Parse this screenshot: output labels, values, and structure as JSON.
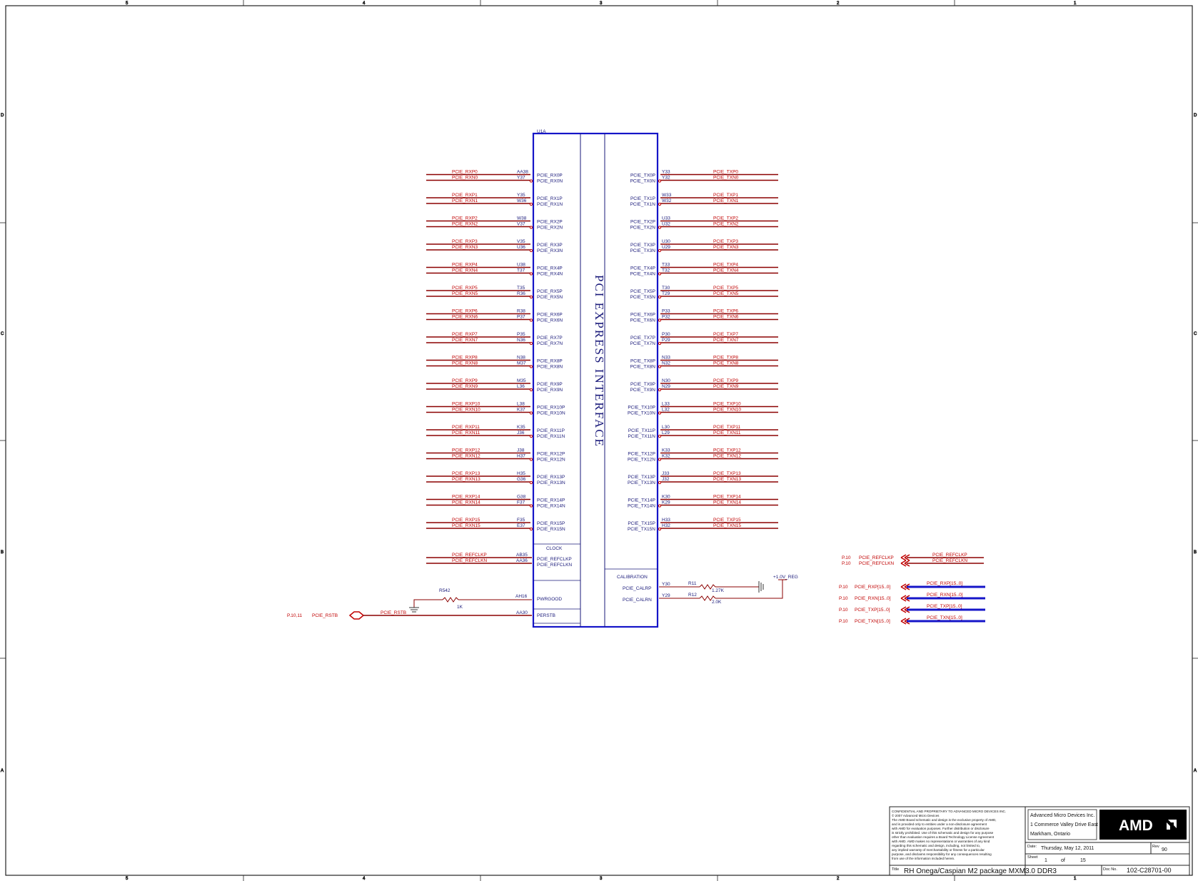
{
  "zones": {
    "top": [
      "5",
      "4",
      "3",
      "2",
      "1"
    ],
    "side": [
      "D",
      "C",
      "B",
      "A"
    ]
  },
  "chip": {
    "ref": "U1A",
    "title": "PCI EXPRESS INTERFACE",
    "clock_label": "CLOCK",
    "calibration_label": "CALIBRATION"
  },
  "rx_lanes": [
    {
      "net_p": "PCIE_RXP0",
      "net_n": "PCIE_RXN0",
      "ball_p": "AA38",
      "ball_n": "Y37",
      "pin_p": "PCIE_RX0P",
      "pin_n": "PCIE_RX0N"
    },
    {
      "net_p": "PCIE_RXP1",
      "net_n": "PCIE_RXN1",
      "ball_p": "Y35",
      "ball_n": "W36",
      "pin_p": "PCIE_RX1P",
      "pin_n": "PCIE_RX1N"
    },
    {
      "net_p": "PCIE_RXP2",
      "net_n": "PCIE_RXN2",
      "ball_p": "W38",
      "ball_n": "V37",
      "pin_p": "PCIE_RX2P",
      "pin_n": "PCIE_RX2N"
    },
    {
      "net_p": "PCIE_RXP3",
      "net_n": "PCIE_RXN3",
      "ball_p": "V35",
      "ball_n": "U36",
      "pin_p": "PCIE_RX3P",
      "pin_n": "PCIE_RX3N"
    },
    {
      "net_p": "PCIE_RXP4",
      "net_n": "PCIE_RXN4",
      "ball_p": "U38",
      "ball_n": "T37",
      "pin_p": "PCIE_RX4P",
      "pin_n": "PCIE_RX4N"
    },
    {
      "net_p": "PCIE_RXP5",
      "net_n": "PCIE_RXN5",
      "ball_p": "T35",
      "ball_n": "R36",
      "pin_p": "PCIE_RX5P",
      "pin_n": "PCIE_RX5N"
    },
    {
      "net_p": "PCIE_RXP6",
      "net_n": "PCIE_RXN6",
      "ball_p": "R38",
      "ball_n": "P37",
      "pin_p": "PCIE_RX6P",
      "pin_n": "PCIE_RX6N"
    },
    {
      "net_p": "PCIE_RXP7",
      "net_n": "PCIE_RXN7",
      "ball_p": "P35",
      "ball_n": "N36",
      "pin_p": "PCIE_RX7P",
      "pin_n": "PCIE_RX7N"
    },
    {
      "net_p": "PCIE_RXP8",
      "net_n": "PCIE_RXN8",
      "ball_p": "N38",
      "ball_n": "M37",
      "pin_p": "PCIE_RX8P",
      "pin_n": "PCIE_RX8N"
    },
    {
      "net_p": "PCIE_RXP9",
      "net_n": "PCIE_RXN9",
      "ball_p": "M35",
      "ball_n": "L36",
      "pin_p": "PCIE_RX9P",
      "pin_n": "PCIE_RX9N"
    },
    {
      "net_p": "PCIE_RXP10",
      "net_n": "PCIE_RXN10",
      "ball_p": "L38",
      "ball_n": "K37",
      "pin_p": "PCIE_RX10P",
      "pin_n": "PCIE_RX10N"
    },
    {
      "net_p": "PCIE_RXP11",
      "net_n": "PCIE_RXN11",
      "ball_p": "K35",
      "ball_n": "J36",
      "pin_p": "PCIE_RX11P",
      "pin_n": "PCIE_RX11N"
    },
    {
      "net_p": "PCIE_RXP12",
      "net_n": "PCIE_RXN12",
      "ball_p": "J38",
      "ball_n": "H37",
      "pin_p": "PCIE_RX12P",
      "pin_n": "PCIE_RX12N"
    },
    {
      "net_p": "PCIE_RXP13",
      "net_n": "PCIE_RXN13",
      "ball_p": "H35",
      "ball_n": "G36",
      "pin_p": "PCIE_RX13P",
      "pin_n": "PCIE_RX13N"
    },
    {
      "net_p": "PCIE_RXP14",
      "net_n": "PCIE_RXN14",
      "ball_p": "G38",
      "ball_n": "F37",
      "pin_p": "PCIE_RX14P",
      "pin_n": "PCIE_RX14N"
    },
    {
      "net_p": "PCIE_RXP15",
      "net_n": "PCIE_RXN15",
      "ball_p": "F35",
      "ball_n": "E37",
      "pin_p": "PCIE_RX15P",
      "pin_n": "PCIE_RX15N"
    }
  ],
  "tx_lanes": [
    {
      "net_p": "PCIE_TXP0",
      "net_n": "PCIE_TXN0",
      "ball_p": "Y33",
      "ball_n": "Y32",
      "pin_p": "PCIE_TX0P",
      "pin_n": "PCIE_TX0N"
    },
    {
      "net_p": "PCIE_TXP1",
      "net_n": "PCIE_TXN1",
      "ball_p": "W33",
      "ball_n": "W32",
      "pin_p": "PCIE_TX1P",
      "pin_n": "PCIE_TX1N"
    },
    {
      "net_p": "PCIE_TXP2",
      "net_n": "PCIE_TXN2",
      "ball_p": "U33",
      "ball_n": "U32",
      "pin_p": "PCIE_TX2P",
      "pin_n": "PCIE_TX2N"
    },
    {
      "net_p": "PCIE_TXP3",
      "net_n": "PCIE_TXN3",
      "ball_p": "U30",
      "ball_n": "U29",
      "pin_p": "PCIE_TX3P",
      "pin_n": "PCIE_TX3N"
    },
    {
      "net_p": "PCIE_TXP4",
      "net_n": "PCIE_TXN4",
      "ball_p": "T33",
      "ball_n": "T32",
      "pin_p": "PCIE_TX4P",
      "pin_n": "PCIE_TX4N"
    },
    {
      "net_p": "PCIE_TXP5",
      "net_n": "PCIE_TXN5",
      "ball_p": "T30",
      "ball_n": "T29",
      "pin_p": "PCIE_TX5P",
      "pin_n": "PCIE_TX5N"
    },
    {
      "net_p": "PCIE_TXP6",
      "net_n": "PCIE_TXN6",
      "ball_p": "P33",
      "ball_n": "P32",
      "pin_p": "PCIE_TX6P",
      "pin_n": "PCIE_TX6N"
    },
    {
      "net_p": "PCIE_TXP7",
      "net_n": "PCIE_TXN7",
      "ball_p": "P30",
      "ball_n": "P29",
      "pin_p": "PCIE_TX7P",
      "pin_n": "PCIE_TX7N"
    },
    {
      "net_p": "PCIE_TXP8",
      "net_n": "PCIE_TXN8",
      "ball_p": "N33",
      "ball_n": "N32",
      "pin_p": "PCIE_TX8P",
      "pin_n": "PCIE_TX8N"
    },
    {
      "net_p": "PCIE_TXP9",
      "net_n": "PCIE_TXN9",
      "ball_p": "N30",
      "ball_n": "N29",
      "pin_p": "PCIE_TX9P",
      "pin_n": "PCIE_TX9N"
    },
    {
      "net_p": "PCIE_TXP10",
      "net_n": "PCIE_TXN10",
      "ball_p": "L33",
      "ball_n": "L32",
      "pin_p": "PCIE_TX10P",
      "pin_n": "PCIE_TX10N"
    },
    {
      "net_p": "PCIE_TXP11",
      "net_n": "PCIE_TXN11",
      "ball_p": "L30",
      "ball_n": "L29",
      "pin_p": "PCIE_TX11P",
      "pin_n": "PCIE_TX11N"
    },
    {
      "net_p": "PCIE_TXP12",
      "net_n": "PCIE_TXN12",
      "ball_p": "K33",
      "ball_n": "K32",
      "pin_p": "PCIE_TX12P",
      "pin_n": "PCIE_TX12N"
    },
    {
      "net_p": "PCIE_TXP13",
      "net_n": "PCIE_TXN13",
      "ball_p": "J33",
      "ball_n": "J32",
      "pin_p": "PCIE_TX13P",
      "pin_n": "PCIE_TX13N"
    },
    {
      "net_p": "PCIE_TXP14",
      "net_n": "PCIE_TXN14",
      "ball_p": "K30",
      "ball_n": "K29",
      "pin_p": "PCIE_TX14P",
      "pin_n": "PCIE_TX14N"
    },
    {
      "net_p": "PCIE_TXP15",
      "net_n": "PCIE_TXN15",
      "ball_p": "H33",
      "ball_n": "H32",
      "pin_p": "PCIE_TX15P",
      "pin_n": "PCIE_TX15N"
    }
  ],
  "refclk": {
    "net_p": "PCIE_REFCLKP",
    "net_n": "PCIE_REFCLKN",
    "ball_p": "AB35",
    "ball_n": "AA36",
    "pin_p": "PCIE_REFCLKP",
    "pin_n": "PCIE_REFCLKN"
  },
  "pwrgood": {
    "pin": "PWRGOOD",
    "ball": "AH16",
    "resistor": "R542",
    "value": "1K"
  },
  "perst": {
    "pin": "PERSTB",
    "ball": "AA30",
    "net": "PCIE_RSTB",
    "page": "P.10,11"
  },
  "calibration": [
    {
      "pin": "PCIE_CALRP",
      "ball": "Y30",
      "resistor": "R11",
      "value": "1.27K"
    },
    {
      "pin": "PCIE_CALRN",
      "ball": "Y29",
      "resistor": "R12",
      "value": "2.0K"
    }
  ],
  "power_rail": "+1.0V_REG",
  "offpage": [
    {
      "page": "P.10",
      "net": "PCIE_REFCLKP",
      "bus_label": "PCIE_REFCLKP"
    },
    {
      "page": "P.10",
      "net": "PCIE_REFCLKN",
      "bus_label": "PCIE_REFCLKN"
    }
  ],
  "offpage_bus": [
    {
      "page": "P.10",
      "net": "PCIE_RXP[15..0]",
      "bus_label": "PCIE_RXP[15..0]"
    },
    {
      "page": "P.10",
      "net": "PCIE_RXN[15..0]",
      "bus_label": "PCIE_RXN[15..0]"
    },
    {
      "page": "P.10",
      "net": "PCIE_TXP[15..0]",
      "bus_label": "PCIE_TXP[15..0]"
    },
    {
      "page": "P.10",
      "net": "PCIE_TXN[15..0]",
      "bus_label": "PCIE_TXN[15..0]"
    }
  ],
  "title_block": {
    "confidential": [
      "CONFIDENTIAL AND PROPRIETARY TO ADVANCED MICRO DEVICES INC.",
      "© 2007 Advanced Micro Devices",
      "The AMD Board schematic and design is the exclusive property of AMD,",
      "and is provided only to entities under a non-disclosure agreement",
      "with AMD for evaluation purposes. Further distribution or disclosure",
      "is strictly prohibited. Use of this schematic and design for any purpose",
      "other than evaluation requires a Board Technology License Agreement",
      "with AMD. AMD makes no representations or warranties of any kind",
      "regarding this schematic and design, including, not limited to,",
      "any implied warranty of merchantability or fitness for a particular",
      "purpose, and disclaims responsibility for any consequences resulting",
      "from use of the information included herein."
    ],
    "company": "Advanced Micro Devices Inc.",
    "address1": "1 Commerce Valley Drive East",
    "address2": "Markham, Ontario",
    "logo": "AMD",
    "date_label": "Date:",
    "date": "Thursday, May 12, 2011",
    "rev_label": "Rev",
    "rev": "90",
    "sheet_label": "Sheet",
    "sheet": "1",
    "of_label": "of",
    "total": "15",
    "title_label": "Title",
    "title": "RH Onega/Caspian M2 package MXM3.0 DDR3",
    "docno_label": "Doc No.",
    "docno": "102-C28701-00"
  }
}
